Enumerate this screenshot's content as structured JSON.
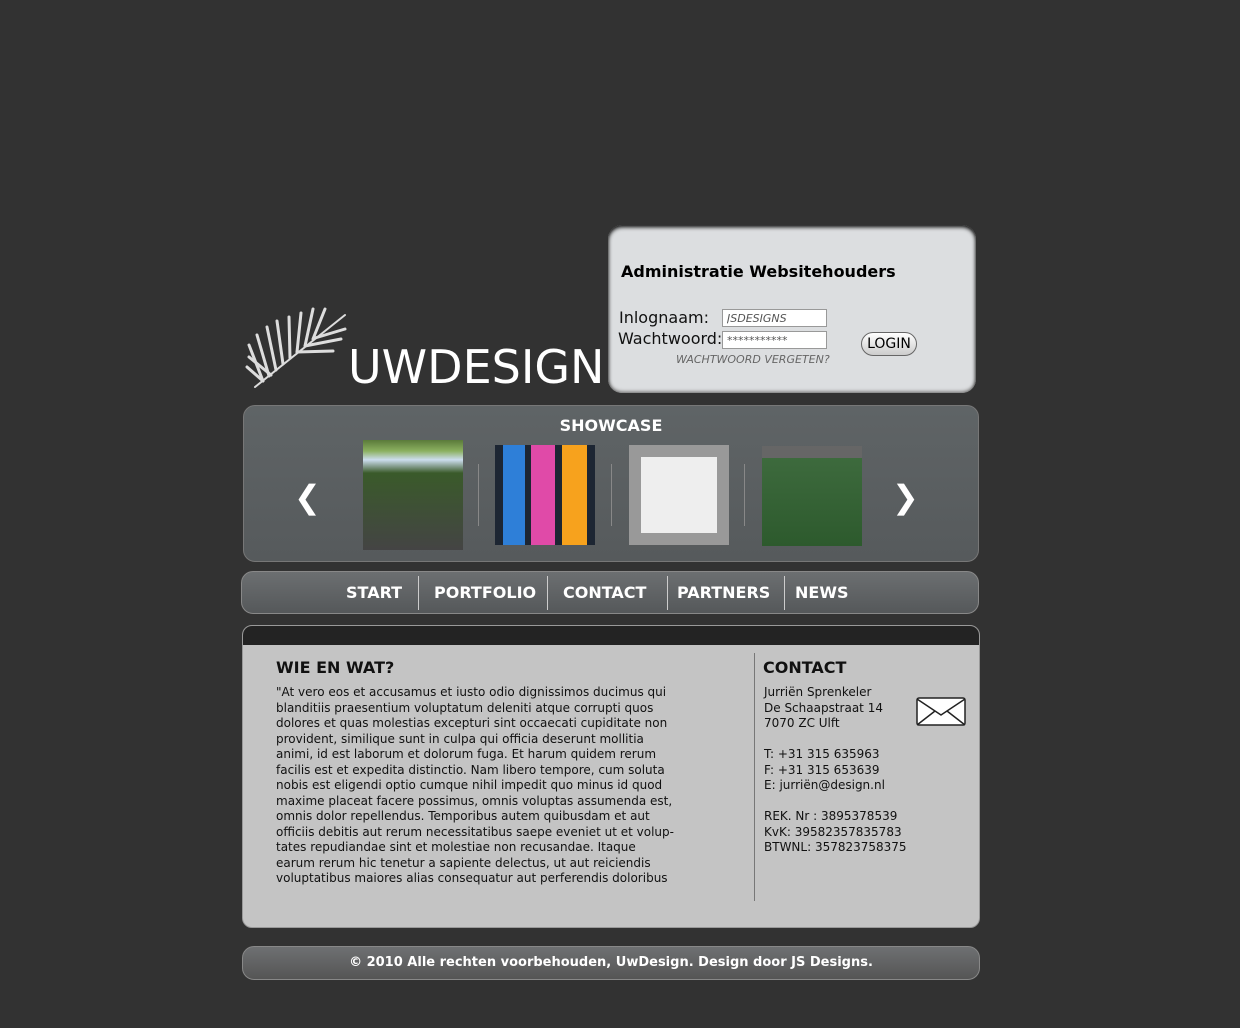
{
  "login": {
    "title": "Administratie Websitehouders",
    "username_label": "Inlognaam:",
    "username_value": "JSDESIGNS",
    "password_label": "Wachtwoord:",
    "password_value": "***********",
    "forgot": "WACHTWOORD VERGETEN?",
    "button": "LOGIN"
  },
  "logo": {
    "text": "UWDESIGN",
    "icon": "palm-leaf-icon"
  },
  "showcase": {
    "title": "SHOWCASE",
    "prev_icon": "arrow-left-icon",
    "next_icon": "arrow-right-icon",
    "thumbs": [
      "site-thumb-green",
      "site-thumb-colorful",
      "site-thumb-white",
      "site-thumb-nature"
    ]
  },
  "nav": [
    "START",
    "PORTFOLIO",
    "CONTACT",
    "PARTNERS",
    "NEWS"
  ],
  "about": {
    "title": "WIE EN WAT?",
    "lines": [
      "\"At vero eos et accusamus et iusto odio dignissimos ducimus qui",
      "blanditiis praesentium voluptatum deleniti atque corrupti quos",
      "dolores et quas molestias excepturi sint occaecati cupiditate non",
      "provident, similique sunt in culpa qui officia deserunt mollitia",
      "animi, id est laborum et dolorum fuga. Et harum quidem rerum",
      "facilis est et expedita distinctio. Nam libero tempore, cum soluta",
      "nobis est eligendi optio cumque nihil impedit quo minus id quod",
      "maxime placeat facere possimus, omnis voluptas assumenda est,",
      "omnis dolor repellendus. Temporibus autem quibusdam et aut",
      "officiis debitis aut rerum necessitatibus saepe eveniet ut et volup-",
      "tates repudiandae sint et molestiae non recusandae. Itaque",
      "earum rerum hic tenetur a sapiente delectus, ut aut reiciendis",
      "voluptatibus maiores alias consequatur aut perferendis doloribus"
    ]
  },
  "contact": {
    "title": "CONTACT",
    "name": "Jurriën Sprenkeler",
    "street": "De Schaapstraat 14",
    "city": "7070 ZC Ulft",
    "phone": "T: +31 315 635963",
    "fax": "F: +31 315 653639",
    "email": "E: jurriën@design.nl",
    "rek": "REK. Nr : 3895378539",
    "kvk": "KvK: 39582357835783",
    "btw": "BTWNL: 357823758375",
    "icon": "envelope-icon"
  },
  "footer": "© 2010 Alle rechten voorbehouden, UwDesign. Design door JS Designs."
}
